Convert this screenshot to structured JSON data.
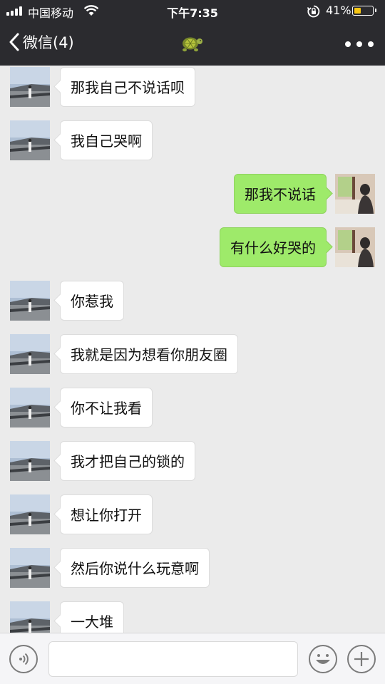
{
  "status_bar": {
    "carrier": "中国移动",
    "time": "下午7:35",
    "battery_percent_text": "41%",
    "battery_level": 0.41,
    "icons": [
      "signal-icon",
      "wifi-icon",
      "orientation-lock-icon",
      "battery-icon"
    ]
  },
  "header": {
    "back_label": "微信(4)",
    "title_icon": "turtle-icon",
    "more_icon": "more-dots-icon"
  },
  "messages": [
    {
      "side": "left",
      "text": "那我自己不说话呗"
    },
    {
      "side": "left",
      "text": "我自己哭啊"
    },
    {
      "side": "right",
      "text": "那我不说话"
    },
    {
      "side": "right",
      "text": "有什么好哭的"
    },
    {
      "side": "left",
      "text": "你惹我"
    },
    {
      "side": "left",
      "text": "我就是因为想看你朋友圈"
    },
    {
      "side": "left",
      "text": "你不让我看"
    },
    {
      "side": "left",
      "text": "我才把自己的锁的"
    },
    {
      "side": "left",
      "text": "想让你打开"
    },
    {
      "side": "left",
      "text": "然后你说什么玩意啊"
    },
    {
      "side": "left",
      "text": "一大堆"
    }
  ],
  "input_bar": {
    "icons": [
      "voice-icon",
      "emoji-icon",
      "plus-icon"
    ],
    "value": ""
  },
  "colors": {
    "header_bg": "#2b2b2f",
    "chat_bg": "#ebebeb",
    "bubble_self": "#9eea6a",
    "bubble_other": "#ffffff",
    "battery_fill": "#f7c613"
  }
}
